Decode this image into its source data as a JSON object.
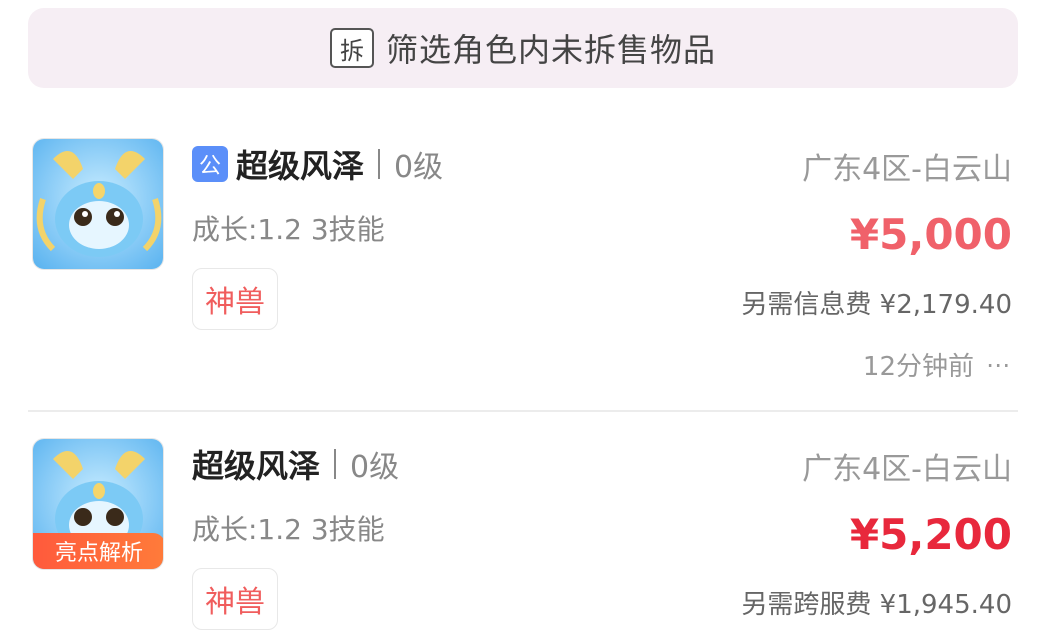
{
  "filter": {
    "icon_char": "拆",
    "label": "筛选角色内未拆售物品"
  },
  "listings": [
    {
      "public_badge": "公",
      "name": "超级风泽",
      "level": "0级",
      "growth": "成长:1.2 3技能",
      "tag": "神兽",
      "server": "广东4区-白云山",
      "price": "¥5,000",
      "fee": "另需信息费 ¥2,179.40",
      "time": "12分钟前",
      "more_icon": "ellipsis-icon"
    },
    {
      "highlight_tag": "亮点解析",
      "name": "超级风泽",
      "level": "0级",
      "growth": "成长:1.2 3技能",
      "tag": "神兽",
      "server": "广东4区-白云山",
      "price": "¥5,200",
      "fee": "另需跨服费 ¥1,945.40"
    }
  ],
  "colors": {
    "banner_bg": "#f6eef4",
    "price_1": "#f0616a",
    "price_2": "#e8283c",
    "tag_text": "#f05d5d",
    "public_badge": "#5b8ff9",
    "highlight_tag": "#ff5a3c"
  }
}
